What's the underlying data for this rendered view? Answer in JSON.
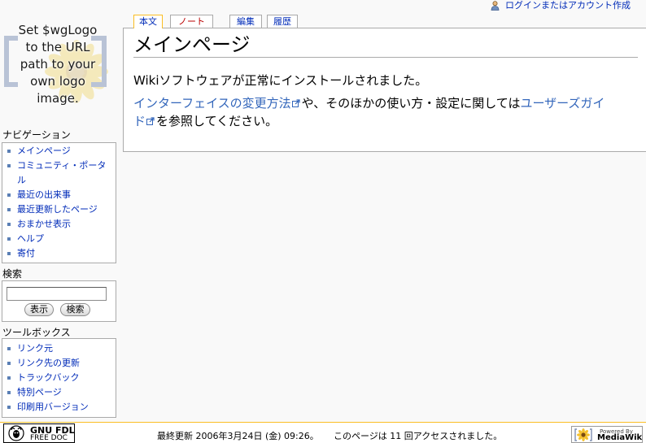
{
  "personal": {
    "login_label": "ログインまたはアカウント作成",
    "icon": "user-icon"
  },
  "logo": {
    "lines": [
      "Set $wgLogo",
      "to the URL",
      "path to your",
      "own logo",
      "image."
    ]
  },
  "tabs": [
    {
      "label": "本文",
      "selected": true,
      "exists": true
    },
    {
      "label": "ノート",
      "selected": false,
      "exists": false
    },
    {
      "label": "編集",
      "selected": false,
      "exists": true
    },
    {
      "label": "履歴",
      "selected": false,
      "exists": true
    }
  ],
  "content": {
    "title": "メインページ",
    "paragraph1": "Wikiソフトウェアが正常にインストールされました。",
    "paragraph2": {
      "link1": "インターフェイスの変更方法",
      "text1": "や、そのほかの使い方・設定に関しては",
      "link2": "ユーザーズガイド",
      "text2": "を参照してください。",
      "link_icon": "external-link-icon"
    }
  },
  "navigation": {
    "heading": "ナビゲーション",
    "items": [
      "メインページ",
      "コミュニティ・ポータル",
      "最近の出来事",
      "最近更新したページ",
      "おまかせ表示",
      "ヘルプ",
      "寄付"
    ]
  },
  "search": {
    "heading": "検索",
    "value": "",
    "go_label": "表示",
    "search_label": "検索"
  },
  "toolbox": {
    "heading": "ツールボックス",
    "items": [
      "リンク元",
      "リンク先の更新",
      "トラックバック",
      "特別ページ",
      "印刷用バージョン"
    ]
  },
  "footer": {
    "copyright_badge": {
      "line1": "GNU FDL",
      "line2": "FREE DOC",
      "icon": "gnu-head-icon"
    },
    "last_modified": "最終更新 2006年3月24日 (金) 09:26。",
    "view_count": "このページは 11 回アクセスされました。",
    "powered_badge": {
      "line1": "Powered By",
      "line2": "MediaWiki",
      "icon": "mediawiki-sunflower-icon"
    }
  },
  "colors": {
    "link": "#002bb8",
    "external_link": "#3366bb",
    "new_link": "#ba0000",
    "border": "#aaaaaa",
    "background": "#f9f9f9",
    "footer_border": "#fabd23"
  }
}
